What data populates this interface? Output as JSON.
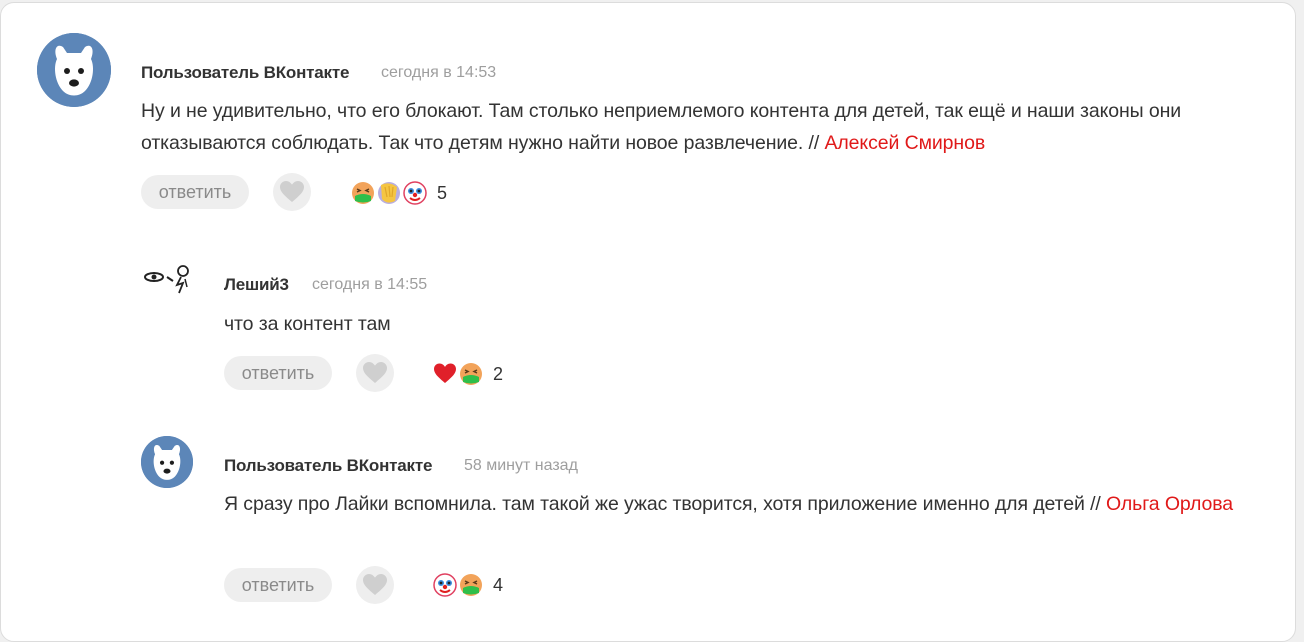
{
  "comments": [
    {
      "author": "Пользователь ВКонтакте",
      "time": "сегодня в 14:53",
      "text": "Ну и не удивительно, что его блокают. Там столько неприемлемого контента для детей, так ещё и наши законы они отказываются соблюдать. Так что детям нужно найти новое развлечение. // ",
      "mention": "Алексей Смирнов",
      "reply_label": "ответить",
      "reactions": [
        "nauseated-face-icon",
        "facepalm-icon",
        "clown-face-icon"
      ],
      "reaction_count": "5"
    },
    {
      "author": "Леший3",
      "time": "сегодня в 14:55",
      "text": "что за контент там",
      "reply_label": "ответить",
      "reactions": [
        "red-heart-icon",
        "nauseated-face-icon"
      ],
      "reaction_count": "2"
    },
    {
      "author": "Пользователь ВКонтакте",
      "time": "58 минут назад",
      "text": "Я сразу про Лайки вспомнила. там такой же ужас творится, хотя приложение именно для детей // ",
      "mention": "Ольга Орлова",
      "reply_label": "ответить",
      "reactions": [
        "clown-face-icon",
        "nauseated-face-icon"
      ],
      "reaction_count": "4"
    }
  ],
  "colors": {
    "mention": "#e01919",
    "avatar_bg": "#5c86b8",
    "button_bg": "#eeeeee",
    "muted_text": "#9e9e9e"
  }
}
